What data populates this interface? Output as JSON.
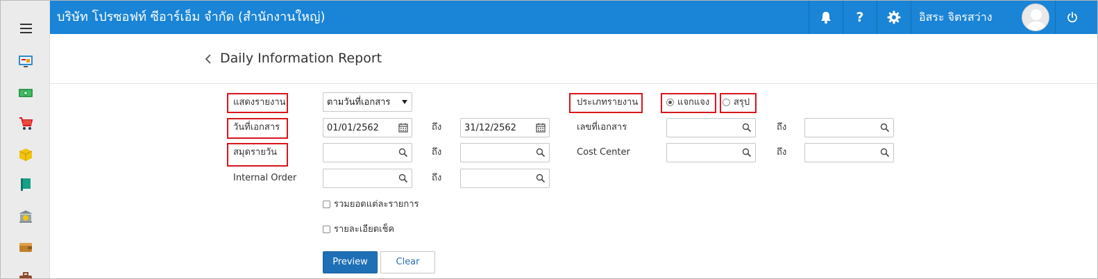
{
  "topbar": {
    "company": "บริษัท โปรซอฟท์ ซีอาร์เอ็ม จำกัด (สำนักงานใหญ่)",
    "username": "อิสระ จิตรสว่าง",
    "help_label": "?",
    "accent": "#1a84d6"
  },
  "sidebar": {
    "items": [
      "dashboard-icon",
      "money-icon",
      "cart-icon",
      "box-icon",
      "book-icon",
      "bank-icon",
      "wallet-icon",
      "briefcase-icon"
    ]
  },
  "header": {
    "title": "Daily Information Report"
  },
  "form": {
    "show_report_label": "แสดงรายงาน",
    "show_report_value": "ตามวันที่เอกสาร",
    "doc_date_label": "วันที่เอกสาร",
    "doc_date_from": "01/01/2562",
    "doc_date_to": "31/12/2562",
    "journal_label": "สมุดรายวัน",
    "internal_order_label": "Internal Order",
    "to_label": "ถึง",
    "report_type_label": "ประเภทรายงาน",
    "report_type_detail": "แจกแจง",
    "report_type_summary": "สรุป",
    "doc_no_label": "เลขที่เอกสาร",
    "cost_center_label": "Cost Center",
    "sum_each_item_label": "รวมยอดแต่ละรายการ",
    "cheque_detail_label": "รายละเอียดเช็ค",
    "preview_label": "Preview",
    "clear_label": "Clear"
  }
}
